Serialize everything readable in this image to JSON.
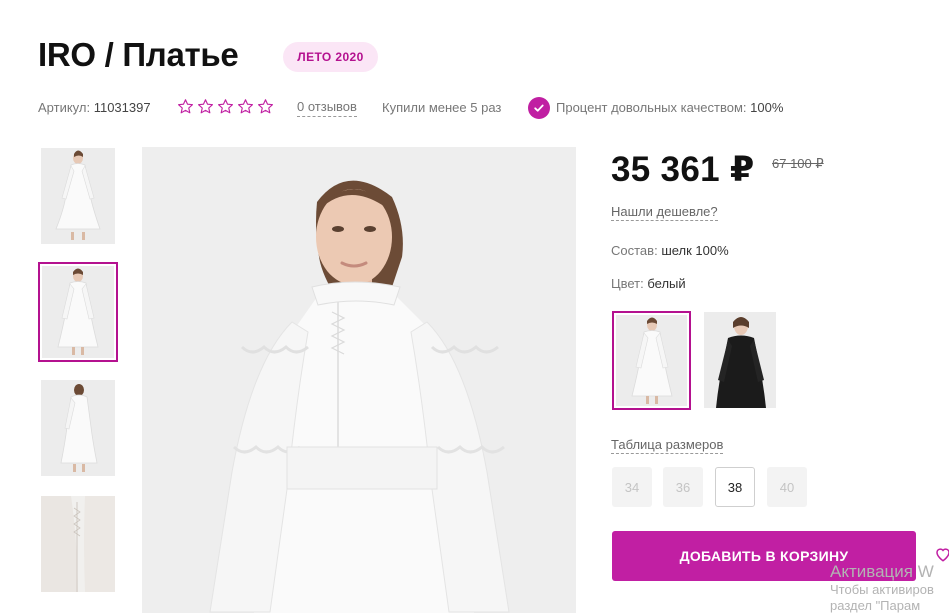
{
  "product": {
    "title": "IRO / Платье",
    "season_badge": "ЛЕТО 2020",
    "sku_label": "Артикул:",
    "sku_value": "11031397",
    "rating_stars": 0,
    "reviews_label": "0 отзывов",
    "bought_text": "Купили менее 5 раз",
    "quality_label": "Процент довольных качеством:",
    "quality_value": "100%"
  },
  "gallery": {
    "thumbnails": [
      "front-view",
      "front-view-selected",
      "side-view",
      "detail-view"
    ],
    "selected_index": 1
  },
  "pricing": {
    "price": "35 361 ₽",
    "old_price": "67 100 ₽",
    "cheaper_link": "Нашли дешевле?"
  },
  "details": {
    "composition_label": "Состав:",
    "composition_value": "шелк 100%",
    "color_label": "Цвет:",
    "color_value": "белый"
  },
  "colors": {
    "options": [
      "white",
      "black"
    ],
    "selected": "white"
  },
  "sizes": {
    "table_link": "Таблица размеров",
    "options": [
      {
        "label": "34",
        "available": false
      },
      {
        "label": "36",
        "available": false
      },
      {
        "label": "38",
        "available": true
      },
      {
        "label": "40",
        "available": false
      }
    ]
  },
  "actions": {
    "add_to_cart": "ДОБАВИТЬ В КОРЗИНУ"
  },
  "watermark": {
    "line1": "Активация W",
    "line2": "Чтобы активиров",
    "line3": "раздел \"Парам"
  },
  "colors_theme": {
    "accent": "#c11fa3",
    "badge_bg": "#fbe6f6",
    "badge_text": "#b4118f"
  }
}
